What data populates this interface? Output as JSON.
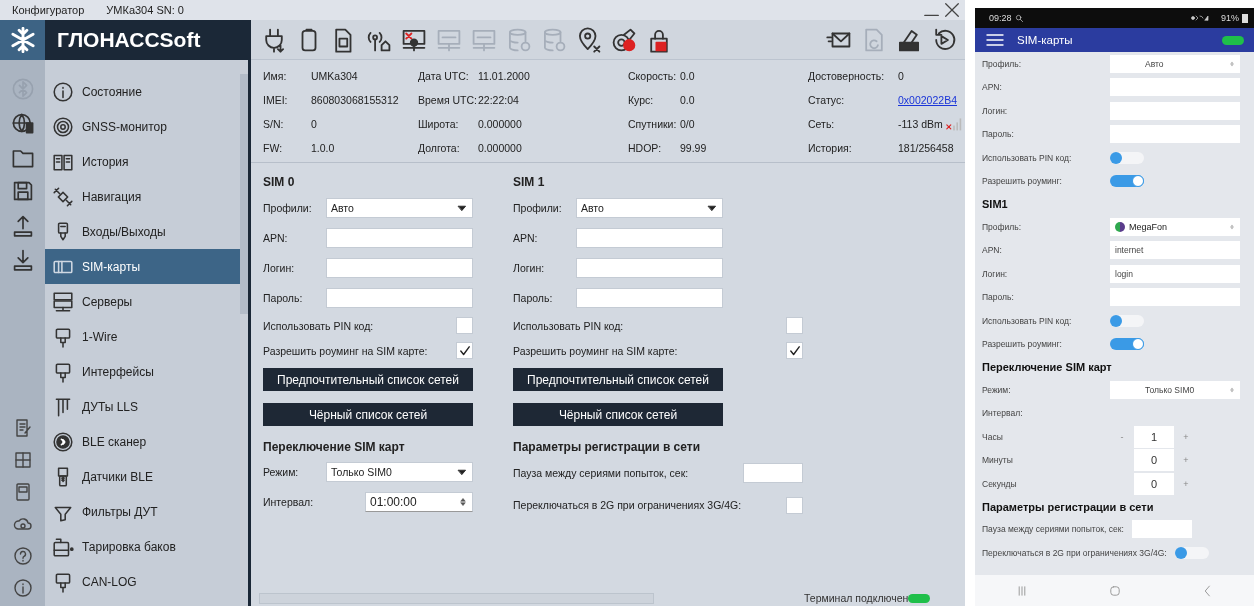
{
  "window": {
    "app_name": "Конфигуратор",
    "device": "УМКа304 SN: 0"
  },
  "logo": {
    "text": "ГЛОНАССSoft"
  },
  "side_toolbar": [
    {
      "disabled": true
    },
    {
      "disabled": false
    },
    {
      "disabled": false
    },
    {
      "disabled": false
    },
    {
      "disabled": false
    },
    {
      "disabled": false
    }
  ],
  "nav": [
    {
      "label": "Состояние",
      "selected": false
    },
    {
      "label": "GNSS-монитор",
      "selected": false
    },
    {
      "label": "История",
      "selected": false
    },
    {
      "label": "Навигация",
      "selected": false
    },
    {
      "label": "Входы/Выходы",
      "selected": false
    },
    {
      "label": "SIM-карты",
      "selected": true
    },
    {
      "label": "Серверы",
      "selected": false
    },
    {
      "label": "1-Wire",
      "selected": false
    },
    {
      "label": "Интерфейсы",
      "selected": false
    },
    {
      "label": "ДУТы LLS",
      "selected": false
    },
    {
      "label": "BLE сканер",
      "selected": false
    },
    {
      "label": "Датчики BLE",
      "selected": false
    },
    {
      "label": "Фильтры ДУТ",
      "selected": false
    },
    {
      "label": "Тарировка баков",
      "selected": false
    },
    {
      "label": "CAN-LOG",
      "selected": false
    }
  ],
  "toolbar": [
    {
      "disabled": false
    },
    {
      "disabled": false
    },
    {
      "disabled": false
    },
    {
      "disabled": false
    },
    {
      "disabled": false
    },
    {
      "disabled": true
    },
    {
      "disabled": true
    },
    {
      "disabled": true
    },
    {
      "disabled": true
    },
    {
      "disabled": false
    },
    {
      "disabled": false
    },
    {
      "disabled": false
    }
  ],
  "toolbar_right": [
    {
      "disabled": false
    },
    {
      "disabled": true
    },
    {
      "disabled": false
    },
    {
      "disabled": false
    }
  ],
  "info": [
    [
      {
        "label": "Имя:",
        "value": "UMKa304",
        "kind": "text"
      },
      {
        "label": "IMEI:",
        "value": "860803068155312",
        "kind": "text"
      },
      {
        "label": "S/N:",
        "value": "0",
        "kind": "text"
      },
      {
        "label": "FW:",
        "value": "1.0.0",
        "kind": "text"
      }
    ],
    [
      {
        "label": "Дата UTC:",
        "value": "11.01.2000",
        "kind": "text"
      },
      {
        "label": "Время UTC:",
        "value": "22:22:04",
        "kind": "text"
      },
      {
        "label": "Широта:",
        "value": "0.000000",
        "kind": "text"
      },
      {
        "label": "Долгота:",
        "value": "0.000000",
        "kind": "text"
      }
    ],
    [
      {
        "label": "Скорость:",
        "value": "0.0",
        "kind": "text"
      },
      {
        "label": "Курс:",
        "value": "0.0",
        "kind": "text"
      },
      {
        "label": "Спутники:",
        "value": "0/0",
        "kind": "text"
      },
      {
        "label": "HDOP:",
        "value": "99.99",
        "kind": "text"
      }
    ],
    [
      {
        "label": "Достоверность:",
        "value": "0",
        "kind": "text"
      },
      {
        "label": "Статус:",
        "value": "0x002022B4",
        "kind": "link"
      },
      {
        "label": "Сеть:",
        "value": "-113 dBm",
        "kind": "signal"
      },
      {
        "label": "История:",
        "value": "181/256458",
        "kind": "text"
      }
    ]
  ],
  "sims": [
    {
      "title": "SIM 0",
      "profile_label": "Профили:",
      "profile": "Авто",
      "apn_label": "APN:",
      "login_label": "Логин:",
      "password_label": "Пароль:",
      "pin_label": "Использовать PIN код:",
      "pin_checked": false,
      "roaming_label": "Разрешить роуминг на SIM карте:",
      "roaming_checked": true,
      "buttons": [
        "Предпочтительный список сетей",
        "Чёрный список сетей"
      ]
    },
    {
      "title": "SIM 1",
      "profile_label": "Профили:",
      "profile": "Авто",
      "apn_label": "APN:",
      "login_label": "Логин:",
      "password_label": "Пароль:",
      "pin_label": "Использовать PIN код:",
      "pin_checked": false,
      "roaming_label": "Разрешить роуминг на SIM карте:",
      "roaming_checked": true,
      "buttons": [
        "Предпочтительный список сетей",
        "Чёрный список сетей"
      ]
    }
  ],
  "switching": {
    "title": "Переключение SIM карт",
    "mode_label": "Режим:",
    "mode": "Только SIM0",
    "interval_label": "Интервал:",
    "interval": "01:00:00"
  },
  "registration": {
    "title": "Параметры регистрации в сети",
    "pause_label": "Пауза между сериями попыток, сек:",
    "fallback_label": "Переключаться в 2G при ограничениях 3G/4G:",
    "fallback_checked": false
  },
  "status_bar": {
    "text": "Терминал подключен",
    "connected": true
  },
  "phone": {
    "time": "09:28",
    "battery": "91%",
    "title": "SIM-карты",
    "connected": true,
    "rows": [
      {
        "kind": "select",
        "label": "Профиль:",
        "value": "Авто"
      },
      {
        "kind": "text",
        "label": "APN:"
      },
      {
        "kind": "text",
        "label": "Логин:"
      },
      {
        "kind": "text",
        "label": "Пароль:"
      },
      {
        "kind": "toggle",
        "label": "Использовать PIN код:",
        "on": false
      },
      {
        "kind": "toggle",
        "label": "Разрешить роуминг:",
        "on": true
      },
      {
        "kind": "heading",
        "label": "SIM1"
      },
      {
        "kind": "select",
        "label": "Профиль:",
        "value": "MegaFon",
        "operator_logo": true
      },
      {
        "kind": "text",
        "label": "APN:",
        "value": "internet"
      },
      {
        "kind": "text",
        "label": "Логин:",
        "value": "login"
      },
      {
        "kind": "text",
        "label": "Пароль:"
      },
      {
        "kind": "toggle",
        "label": "Использовать PIN код:",
        "on": false
      },
      {
        "kind": "toggle",
        "label": "Разрешить роуминг:",
        "on": true
      },
      {
        "kind": "heading",
        "label": "Переключение SIM карт"
      },
      {
        "kind": "select",
        "label": "Режим:",
        "value": "Только SIM0"
      },
      {
        "kind": "label",
        "label": "Интервал:"
      },
      {
        "kind": "stepper",
        "label": "Часы",
        "value": "1",
        "minus": "-",
        "plus": "+"
      },
      {
        "kind": "stepper",
        "label": "Минуты",
        "value": "0",
        "plus": "+"
      },
      {
        "kind": "stepper",
        "label": "Секунды",
        "value": "0",
        "plus": "+"
      },
      {
        "kind": "heading",
        "label": "Параметры регистрации в сети"
      },
      {
        "kind": "text",
        "label": "Пауза между сериями попыток, сек:",
        "short": true
      },
      {
        "kind": "toggle",
        "label": "Переключаться в 2G при ограничениях 3G/4G:",
        "on": false
      }
    ]
  }
}
